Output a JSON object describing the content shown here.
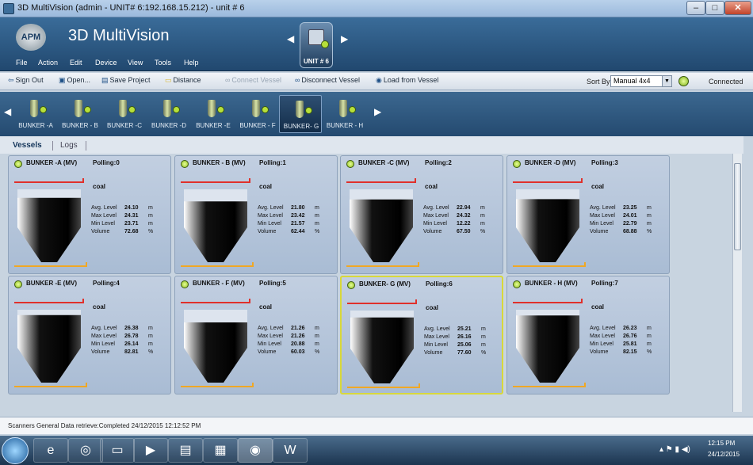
{
  "window": {
    "title": "3D MultiVision (admin - UNIT# 6:192.168.15.212) - unit # 6",
    "min": "–",
    "max": "□",
    "close": "✕"
  },
  "header": {
    "logo": "APM",
    "app_title": "3D MultiVision",
    "unit_label": "UNIT # 6"
  },
  "menu": [
    "File",
    "Action",
    "Edit",
    "Device",
    "View",
    "Tools",
    "Help"
  ],
  "toolbar": {
    "sign_out": "Sign Out",
    "open": "Open...",
    "save_project": "Save Project",
    "distance": "Distance",
    "connect_vessel": "Connect Vessel",
    "disconnect_vessel": "Disconnect Vessel",
    "load_from_vessel": "Load from Vessel",
    "sort_by_label": "Sort By:",
    "sort_by_value": "Manual 4x4",
    "status": "Connected"
  },
  "bunkers": [
    "BUNKER -A",
    "BUNKER - B",
    "BUNKER -C",
    "BUNKER -D",
    "BUNKER -E",
    "BUNKER - F",
    "BUNKER- G",
    "BUNKER - H"
  ],
  "selected_bunker": "BUNKER- G",
  "tabs": {
    "vessels": "Vessels",
    "logs": "Logs"
  },
  "labels": {
    "avg": "Avg. Level",
    "max": "Max Level",
    "min": "Min Level",
    "volume": "Volume",
    "m": "m",
    "pct": "%"
  },
  "vessels": [
    {
      "name": "BUNKER -A (MV)",
      "polling": "Polling:0",
      "material": "coal",
      "avg": "24.10",
      "max": "24.31",
      "min": "23.71",
      "volume": "72.68",
      "fill": 0.73
    },
    {
      "name": "BUNKER - B (MV)",
      "polling": "Polling:1",
      "material": "coal",
      "avg": "21.80",
      "max": "23.42",
      "min": "21.57",
      "volume": "62.44",
      "fill": 0.62
    },
    {
      "name": "BUNKER -C (MV)",
      "polling": "Polling:2",
      "material": "coal",
      "avg": "22.94",
      "max": "24.32",
      "min": "12.22",
      "volume": "67.50",
      "fill": 0.68
    },
    {
      "name": "BUNKER -D (MV)",
      "polling": "Polling:3",
      "material": "coal",
      "avg": "23.25",
      "max": "24.01",
      "min": "22.79",
      "volume": "68.88",
      "fill": 0.69
    },
    {
      "name": "BUNKER -E (MV)",
      "polling": "Polling:4",
      "material": "coal",
      "avg": "26.38",
      "max": "26.78",
      "min": "26.14",
      "volume": "82.81",
      "fill": 0.83
    },
    {
      "name": "BUNKER - F (MV)",
      "polling": "Polling:5",
      "material": "coal",
      "avg": "21.26",
      "max": "21.26",
      "min": "20.88",
      "volume": "60.03",
      "fill": 0.6
    },
    {
      "name": "BUNKER- G (MV)",
      "polling": "Polling:6",
      "material": "coal",
      "avg": "25.21",
      "max": "26.16",
      "min": "25.06",
      "volume": "77.60",
      "fill": 0.78
    },
    {
      "name": "BUNKER - H (MV)",
      "polling": "Polling:7",
      "material": "coal",
      "avg": "26.23",
      "max": "26.76",
      "min": "25.81",
      "volume": "82.15",
      "fill": 0.82
    }
  ],
  "status_bar": "Scanners General Data retrieve:Completed 24/12/2015 12:12:52 PM",
  "taskbar": {
    "time": "12:15 PM",
    "date": "24/12/2015"
  }
}
